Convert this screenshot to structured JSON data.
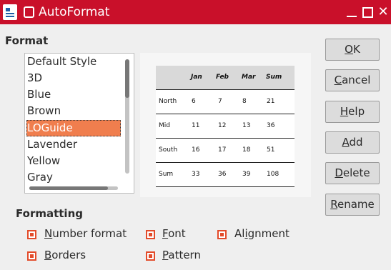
{
  "window": {
    "title": "AutoFormat"
  },
  "format_section": {
    "label": "Format"
  },
  "format_list": {
    "items": [
      "Default Style",
      "3D",
      "Blue",
      "Brown",
      "LOGuide",
      "Lavender",
      "Yellow",
      "Gray"
    ],
    "selected": "LOGuide"
  },
  "preview_table": {
    "header": [
      "",
      "Jan",
      "Feb",
      "Mar",
      "Sum"
    ],
    "rows": [
      [
        "North",
        "6",
        "7",
        "8",
        "21"
      ],
      [
        "Mid",
        "11",
        "12",
        "13",
        "36"
      ],
      [
        "South",
        "16",
        "17",
        "18",
        "51"
      ],
      [
        "Sum",
        "33",
        "36",
        "39",
        "108"
      ]
    ]
  },
  "buttons": {
    "ok": {
      "label": "OK",
      "accesskey": "O",
      "rest": "K"
    },
    "cancel": {
      "label": "Cancel",
      "accesskey": "C",
      "rest": "ancel"
    },
    "help": {
      "label": "Help",
      "accesskey": "H",
      "rest": "elp"
    },
    "add": {
      "label": "Add",
      "accesskey": "A",
      "rest": "dd"
    },
    "delete": {
      "label": "Delete",
      "accesskey": "D",
      "rest": "elete"
    },
    "rename": {
      "label": "Rename",
      "accesskey": "R",
      "rest": "ename"
    }
  },
  "formatting_section": {
    "label": "Formatting"
  },
  "options": {
    "number_format": {
      "label": "Number format",
      "accesskey": "N",
      "rest": "umber format",
      "checked": true
    },
    "font": {
      "label": "Font",
      "accesskey": "F",
      "rest": "ont",
      "checked": true
    },
    "alignment": {
      "label": "Alignment",
      "pre": "Al",
      "accesskey": "i",
      "rest": "gnment",
      "checked": true
    },
    "borders": {
      "label": "Borders",
      "accesskey": "B",
      "rest": "orders",
      "checked": true
    },
    "pattern": {
      "label": "Pattern",
      "accesskey": "P",
      "rest": "attern",
      "checked": true
    }
  },
  "colors": {
    "titlebar": "#c9102a",
    "selection": "#f07e4e",
    "checkbox": "#e34b2a"
  }
}
